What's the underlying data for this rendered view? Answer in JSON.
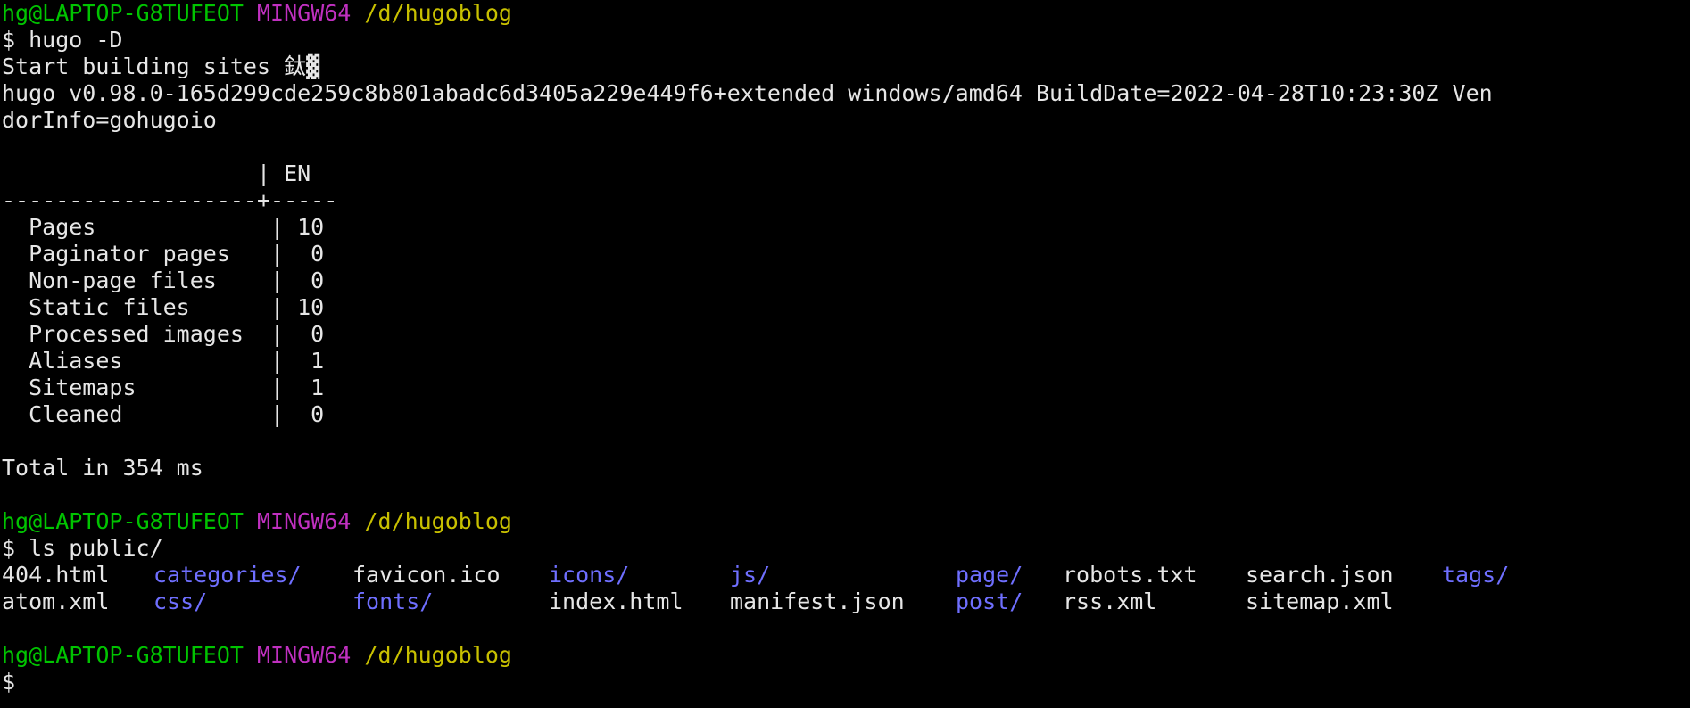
{
  "prompt1": {
    "user": "hg@LAPTOP-G8TUFEOT",
    "shell": "MINGW64",
    "path": "/d/hugoblog"
  },
  "cmd1": "$ hugo -D",
  "build_start": "Start building sites 鈦▓",
  "version_line1": "hugo v0.98.0-165d299cde259c8b801abadc6d3405a229e449f6+extended windows/amd64 BuildDate=2022-04-28T10:23:30Z Ven",
  "version_line2": "dorInfo=gohugoio",
  "table": {
    "header": "                   | EN",
    "separator": "-------------------+-----",
    "rows": [
      "  Pages             | 10",
      "  Paginator pages   |  0",
      "  Non-page files    |  0",
      "  Static files      | 10",
      "  Processed images  |  0",
      "  Aliases           |  1",
      "  Sitemaps          |  1",
      "  Cleaned           |  0"
    ]
  },
  "total": "Total in 354 ms",
  "prompt2": {
    "user": "hg@LAPTOP-G8TUFEOT",
    "shell": "MINGW64",
    "path": "/d/hugoblog"
  },
  "cmd2": "$ ls public/",
  "ls_row1": [
    {
      "name": "404.html",
      "dir": false
    },
    {
      "name": "categories/",
      "dir": true
    },
    {
      "name": "favicon.ico",
      "dir": false
    },
    {
      "name": "icons/",
      "dir": true
    },
    {
      "name": "js/",
      "dir": true
    },
    {
      "name": "page/",
      "dir": true
    },
    {
      "name": "robots.txt",
      "dir": false
    },
    {
      "name": "search.json",
      "dir": false
    },
    {
      "name": "tags/",
      "dir": true
    }
  ],
  "ls_row2": [
    {
      "name": "atom.xml",
      "dir": false
    },
    {
      "name": "css/",
      "dir": true
    },
    {
      "name": "fonts/",
      "dir": true
    },
    {
      "name": "index.html",
      "dir": false
    },
    {
      "name": "manifest.json",
      "dir": false
    },
    {
      "name": "post/",
      "dir": true
    },
    {
      "name": "rss.xml",
      "dir": false
    },
    {
      "name": "sitemap.xml",
      "dir": false
    }
  ],
  "prompt3": {
    "user": "hg@LAPTOP-G8TUFEOT",
    "shell": "MINGW64",
    "path": "/d/hugoblog"
  },
  "cursor_prompt": "$",
  "colors": {
    "user": "#00c400",
    "shell": "#c030c0",
    "path": "#c8c000",
    "dir": "#6f6fff",
    "text": "#e6e6e6",
    "background": "#000000"
  }
}
